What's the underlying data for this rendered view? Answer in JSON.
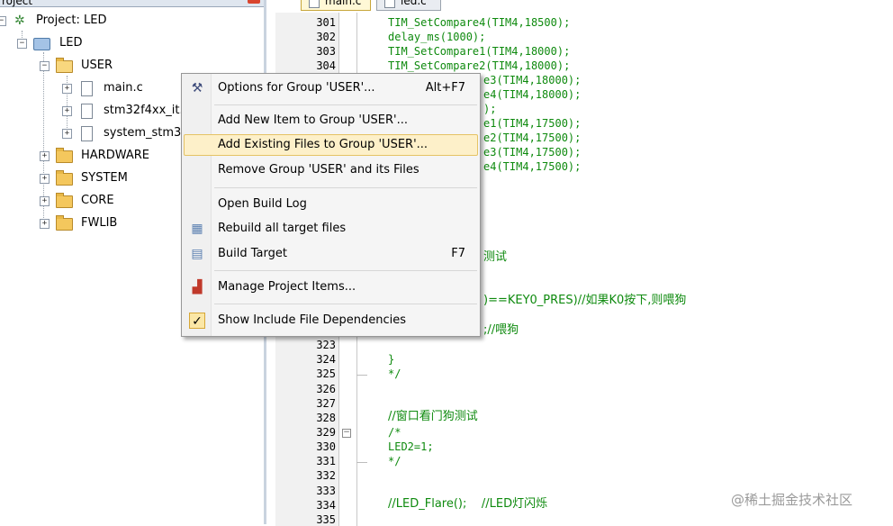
{
  "project_pane": {
    "header_title": "roject",
    "tree": [
      {
        "label": "Project: LED",
        "icon": "project-icon"
      },
      {
        "label": "LED",
        "icon": "target-icon"
      },
      {
        "label": "USER",
        "icon": "open-folder-icon"
      },
      {
        "label": "main.c",
        "icon": "file-icon"
      },
      {
        "label": "stm32f4xx_it.",
        "icon": "file-icon"
      },
      {
        "label": "system_stm3",
        "icon": "file-icon"
      },
      {
        "label": "HARDWARE",
        "icon": "folder-icon"
      },
      {
        "label": "SYSTEM",
        "icon": "folder-icon"
      },
      {
        "label": "CORE",
        "icon": "folder-icon"
      },
      {
        "label": "FWLIB",
        "icon": "folder-icon"
      }
    ]
  },
  "editor": {
    "tabs": [
      {
        "label": "main.c",
        "active": true
      },
      {
        "label": "led.c",
        "active": false
      }
    ],
    "lines_top": [
      {
        "no": "301",
        "code": "TIM_SetCompare4(TIM4,18500);"
      },
      {
        "no": "302",
        "code": "delay_ms(1000);"
      },
      {
        "no": "303",
        "code": "TIM_SetCompare1(TIM4,18000);"
      },
      {
        "no": "304",
        "code": "TIM_SetCompare2(TIM4,18000);"
      },
      {
        "no": "",
        "code": "e3(TIM4,18000);"
      },
      {
        "no": "",
        "code": "e4(TIM4,18000);"
      },
      {
        "no": "",
        "code": ");"
      },
      {
        "no": "",
        "code": "e1(TIM4,17500);"
      },
      {
        "no": "",
        "code": "e2(TIM4,17500);"
      },
      {
        "no": "",
        "code": "e3(TIM4,17500);"
      },
      {
        "no": "",
        "code": "e4(TIM4,17500);"
      }
    ],
    "partial_texts": [
      {
        "text": "测试"
      },
      {
        "text": ")==KEY0_PRES)//如果K0按下,则喂狗"
      },
      {
        "text": ";//喂狗"
      }
    ],
    "lines_bottom": [
      {
        "no": "323",
        "code": ""
      },
      {
        "no": "324",
        "code": "}"
      },
      {
        "no": "325",
        "code": "*/"
      },
      {
        "no": "326",
        "code": ""
      },
      {
        "no": "327",
        "code": ""
      },
      {
        "no": "328",
        "code": "//窗口看门狗测试"
      },
      {
        "no": "329",
        "code": "/*"
      },
      {
        "no": "330",
        "code": "LED2=1;"
      },
      {
        "no": "331",
        "code": "*/"
      },
      {
        "no": "332",
        "code": ""
      },
      {
        "no": "333",
        "code": ""
      },
      {
        "no": "334",
        "code": "//LED_Flare();    //LED灯闪烁"
      },
      {
        "no": "335",
        "code": ""
      }
    ]
  },
  "context_menu": {
    "items": [
      {
        "label": "Options for Group 'USER'...",
        "shortcut": "Alt+F7",
        "icon": "options-icon"
      },
      {
        "label": "Add New  Item to Group 'USER'...",
        "shortcut": "",
        "icon": ""
      },
      {
        "label": "Add Existing Files to Group 'USER'...",
        "shortcut": "",
        "icon": "",
        "highlighted": true
      },
      {
        "label": "Remove Group 'USER' and its Files",
        "shortcut": "",
        "icon": ""
      },
      {
        "label": "Open Build Log",
        "shortcut": "",
        "icon": ""
      },
      {
        "label": "Rebuild all target files",
        "shortcut": "",
        "icon": "rebuild-icon"
      },
      {
        "label": "Build Target",
        "shortcut": "F7",
        "icon": "build-icon"
      },
      {
        "label": "Manage Project Items...",
        "shortcut": "",
        "icon": "manage-items-icon"
      },
      {
        "label": "Show Include File Dependencies",
        "shortcut": "",
        "icon": "check-icon",
        "checked": true
      }
    ]
  },
  "watermark": "@稀土掘金技术社区",
  "colors": {
    "code_green": "#0e8a0e",
    "menu_highlight": "#fdf0c9",
    "folder": "#f4c75d"
  }
}
